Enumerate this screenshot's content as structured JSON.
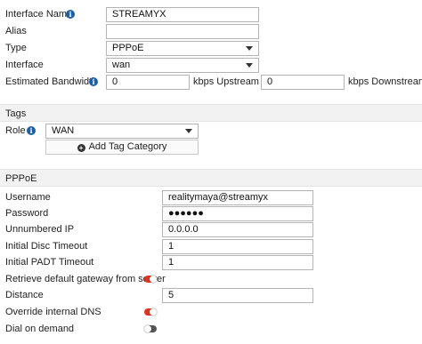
{
  "interface": {
    "name_label": "Interface Name",
    "name_value": "STREAMYX",
    "alias_label": "Alias",
    "alias_value": "",
    "type_label": "Type",
    "type_value": "PPPoE",
    "interface_label": "Interface",
    "interface_value": "wan",
    "bandwidth_label": "Estimated Bandwidth",
    "upstream_value": "0",
    "upstream_unit": "kbps Upstream",
    "downstream_value": "0",
    "downstream_unit": "kbps Downstream"
  },
  "tags": {
    "section_title": "Tags",
    "role_label": "Role",
    "role_value": "WAN",
    "add_tag_label": "Add Tag Category"
  },
  "pppoe": {
    "section_title": "PPPoE",
    "username_label": "Username",
    "username_value": "realitymaya@streamyx",
    "password_label": "Password",
    "password_value": "●●●●●●",
    "unnumbered_ip_label": "Unnumbered IP",
    "unnumbered_ip_value": "0.0.0.0",
    "disc_timeout_label": "Initial Disc Timeout",
    "disc_timeout_value": "1",
    "padt_timeout_label": "Initial PADT Timeout",
    "padt_timeout_value": "1",
    "default_gw_label": "Retrieve default gateway from server",
    "default_gw_enabled": true,
    "distance_label": "Distance",
    "distance_value": "5",
    "override_dns_label": "Override internal DNS",
    "override_dns_enabled": true,
    "dial_on_demand_label": "Dial on demand",
    "dial_on_demand_enabled": false
  },
  "colors": {
    "toggle_on": "#e0321f",
    "toggle_off": "#555555",
    "info_icon": "#1d5fa6"
  },
  "icons": {
    "info": "info-icon",
    "dropdown": "chevron-down-icon",
    "add": "plus-circle-icon"
  }
}
